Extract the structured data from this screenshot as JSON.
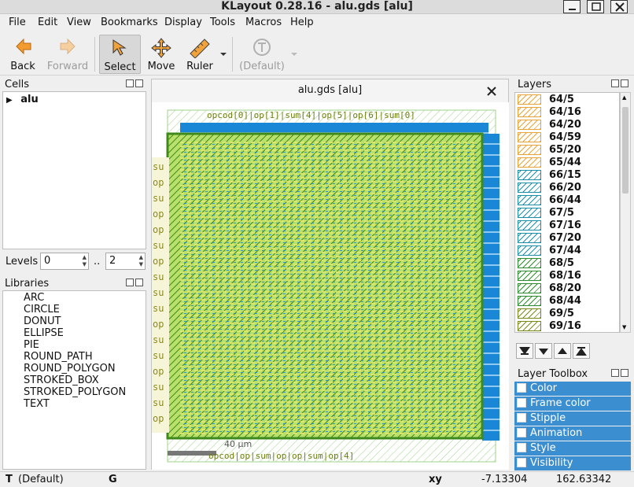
{
  "window": {
    "title": "KLayout 0.28.16 - alu.gds [alu]"
  },
  "menu": [
    "File",
    "Edit",
    "View",
    "Bookmarks",
    "Display",
    "Tools",
    "Macros",
    "Help"
  ],
  "toolbar": {
    "back": "Back",
    "forward": "Forward",
    "select": "Select",
    "move": "Move",
    "ruler": "Ruler",
    "default": "(Default)"
  },
  "cells": {
    "title": "Cells",
    "items": [
      "alu"
    ]
  },
  "levels": {
    "label": "Levels",
    "from": "0",
    "sep": "..",
    "to": "2"
  },
  "libraries": {
    "title": "Libraries",
    "items": [
      "ARC",
      "CIRCLE",
      "DONUT",
      "ELLIPSE",
      "PIE",
      "ROUND_PATH",
      "ROUND_POLYGON",
      "STROKED_BOX",
      "STROKED_POLYGON",
      "TEXT"
    ]
  },
  "view": {
    "tab_title": "alu.gds [alu]",
    "scale_label": "40 µm"
  },
  "layers": {
    "title": "Layers",
    "items": [
      {
        "name": "64/5",
        "color": "#e8a437"
      },
      {
        "name": "64/16",
        "color": "#e8a437"
      },
      {
        "name": "64/20",
        "color": "#e8a437"
      },
      {
        "name": "64/59",
        "color": "#e8a437"
      },
      {
        "name": "65/20",
        "color": "#e8a437"
      },
      {
        "name": "65/44",
        "color": "#e8a437"
      },
      {
        "name": "66/15",
        "color": "#1b8fa8"
      },
      {
        "name": "66/20",
        "color": "#1b8fa8"
      },
      {
        "name": "66/44",
        "color": "#1b8fa8"
      },
      {
        "name": "67/5",
        "color": "#1b8fa8"
      },
      {
        "name": "67/16",
        "color": "#1b8fa8"
      },
      {
        "name": "67/20",
        "color": "#1b8fa8"
      },
      {
        "name": "67/44",
        "color": "#1b8fa8"
      },
      {
        "name": "68/5",
        "color": "#2e8b2e"
      },
      {
        "name": "68/16",
        "color": "#2e8b2e"
      },
      {
        "name": "68/20",
        "color": "#2e8b2e"
      },
      {
        "name": "68/44",
        "color": "#2e8b2e"
      },
      {
        "name": "69/5",
        "color": "#7a8a1a"
      },
      {
        "name": "69/16",
        "color": "#7a8a1a"
      }
    ]
  },
  "layer_toolbox": {
    "title": "Layer Toolbox",
    "items": [
      "Color",
      "Frame color",
      "Stipple",
      "Animation",
      "Style",
      "Visibility"
    ]
  },
  "status": {
    "mode_key": "T",
    "mode": "(Default)",
    "grid_key": "G",
    "coord_label": "xy",
    "x": "-7.13304",
    "y": "162.63342"
  },
  "colors": {
    "selection": "#3b8ed0",
    "layout_green": "#3f8a1c",
    "layout_yellow": "#c8e04a",
    "layout_blue": "#1a86d6"
  }
}
